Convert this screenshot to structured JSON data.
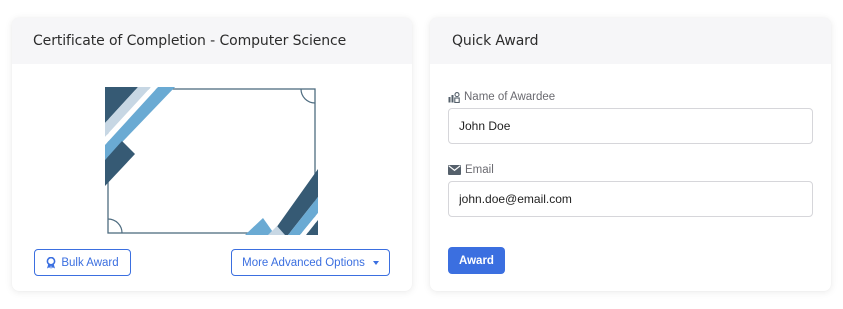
{
  "certificate_card": {
    "title": "Certificate of Completion - Computer Science",
    "bulk_award_label": "Bulk Award",
    "more_options_label": "More Advanced Options"
  },
  "quick_award": {
    "title": "Quick Award",
    "name_label": "Name of Awardee",
    "name_value": "John Doe",
    "email_label": "Email",
    "email_value": "john.doe@email.com",
    "award_label": "Award"
  },
  "colors": {
    "accent": "#3b6fe0",
    "cert_dark": "#365a74",
    "cert_light": "#6aaad3",
    "cert_border": "#4e6c80"
  },
  "icons": {
    "bulk_award": "award-ribbon-icon",
    "more_options": "caret-down-icon",
    "name": "name-tag-icon",
    "email": "envelope-icon"
  }
}
